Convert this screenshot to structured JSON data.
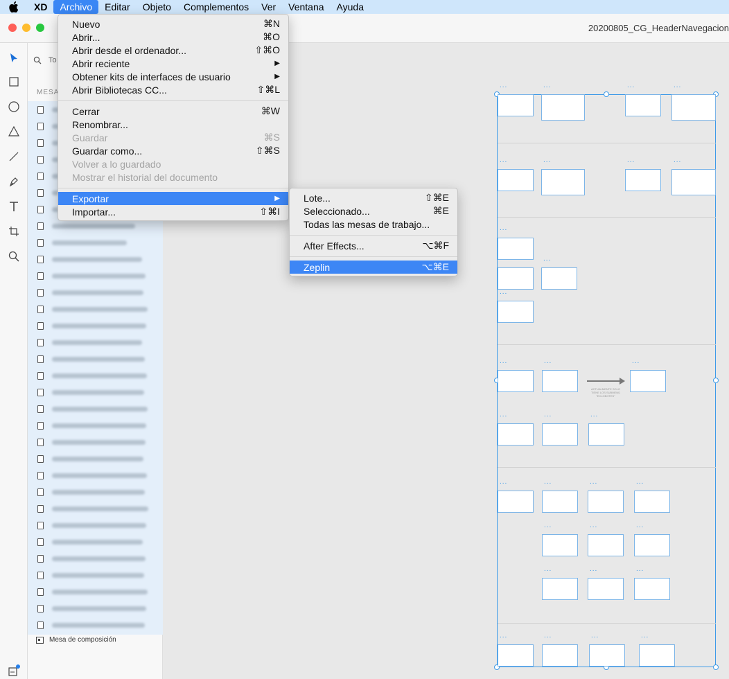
{
  "menubar": {
    "items": [
      {
        "label": "XD"
      },
      {
        "label": "Archivo"
      },
      {
        "label": "Editar"
      },
      {
        "label": "Objeto"
      },
      {
        "label": "Complementos"
      },
      {
        "label": "Ver"
      },
      {
        "label": "Ventana"
      },
      {
        "label": "Ayuda"
      }
    ]
  },
  "window": {
    "title": "20200805_CG_HeaderNavegacion"
  },
  "layers": {
    "search_placeholder": "To",
    "heading": "MESAS",
    "footer_label": "Mesa de composición"
  },
  "archivo_menu": {
    "items": [
      {
        "label": "Nuevo",
        "shortcut": "⌘N"
      },
      {
        "label": "Abrir...",
        "shortcut": "⌘O"
      },
      {
        "label": "Abrir desde el ordenador...",
        "shortcut": "⇧⌘O"
      },
      {
        "label": "Abrir reciente",
        "shortcut": ""
      },
      {
        "label": "Obtener kits de interfaces de usuario",
        "shortcut": ""
      },
      {
        "label": "Abrir Bibliotecas CC...",
        "shortcut": "⇧⌘L"
      },
      {
        "label": "Cerrar",
        "shortcut": "⌘W"
      },
      {
        "label": "Renombrar...",
        "shortcut": ""
      },
      {
        "label": "Guardar",
        "shortcut": "⌘S"
      },
      {
        "label": "Guardar como...",
        "shortcut": "⇧⌘S"
      },
      {
        "label": "Volver a lo guardado",
        "shortcut": ""
      },
      {
        "label": "Mostrar el historial del documento",
        "shortcut": ""
      },
      {
        "label": "Exportar",
        "shortcut": ""
      },
      {
        "label": "Importar...",
        "shortcut": "⇧⌘I"
      }
    ]
  },
  "exportar_menu": {
    "items": [
      {
        "label": "Lote...",
        "shortcut": "⇧⌘E"
      },
      {
        "label": "Seleccionado...",
        "shortcut": "⌘E"
      },
      {
        "label": "Todas las mesas de trabajo...",
        "shortcut": ""
      },
      {
        "label": "After Effects...",
        "shortcut": "⌥⌘F"
      },
      {
        "label": "Zeplin",
        "shortcut": "⌥⌘E"
      }
    ]
  },
  "canvas": {
    "frame_label": "...",
    "note_text": "ACTUALMENTE SOLO TIENE LOS SUBMENÚ \"ECLOBOTES\""
  },
  "colors": {
    "menubar_bg": "#cfe6fb",
    "highlight": "#3d86f5",
    "selection": "#3d9ae8"
  }
}
